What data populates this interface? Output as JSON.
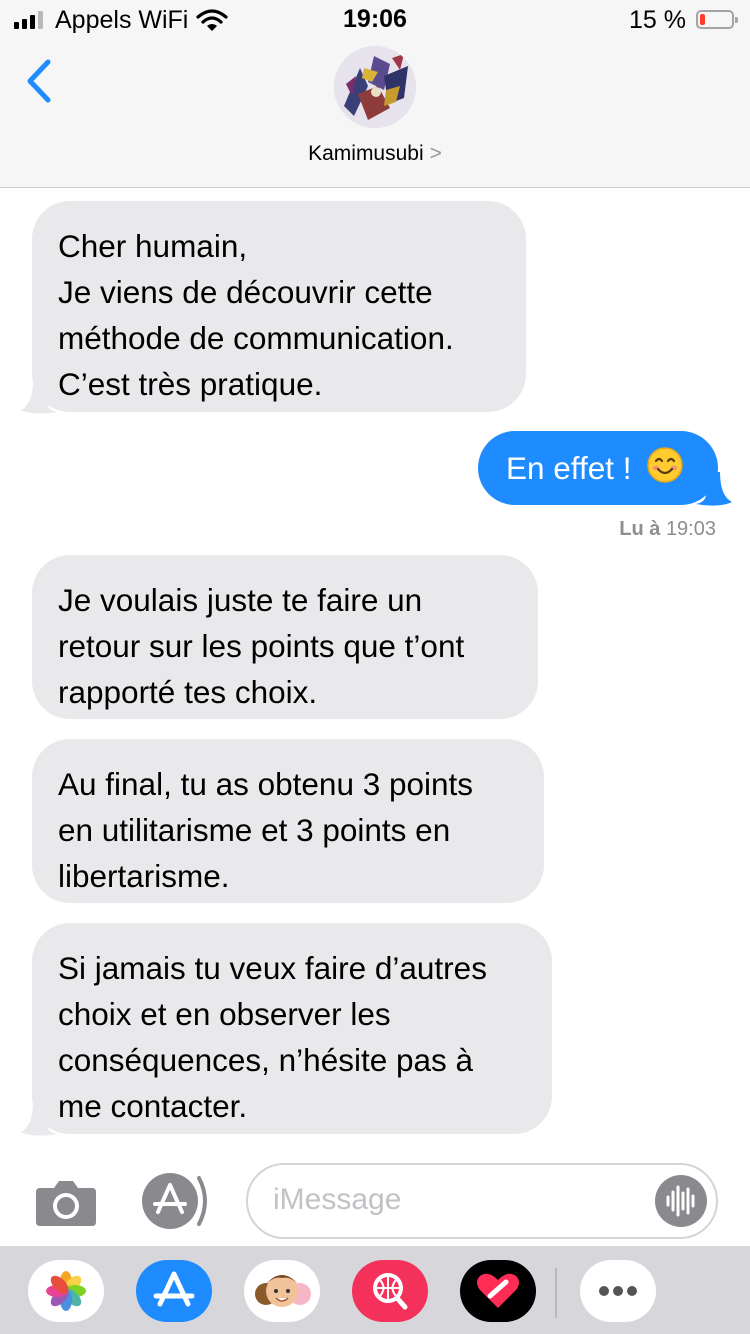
{
  "status_bar": {
    "carrier": "Appels WiFi",
    "time": "19:06",
    "battery_percent": "15 %",
    "battery_level": 0.15
  },
  "header": {
    "contact_name": "Kamimusubi",
    "contact_chevron": ">"
  },
  "messages": [
    {
      "direction": "incoming",
      "lines": [
        "Cher humain,",
        "Je viens de découvrir cette",
        "méthode de communication.",
        "C’est très pratique."
      ]
    },
    {
      "direction": "outgoing",
      "lines": [
        "En effet !"
      ],
      "emoji": "smiling-face-icon"
    },
    {
      "direction": "incoming",
      "lines": [
        "Je voulais juste te faire un",
        "retour sur les points que t’ont",
        "rapporté tes choix."
      ]
    },
    {
      "direction": "incoming",
      "lines": [
        "Au final, tu as obtenu 3 points",
        "en utilitarisme et 3 points en",
        "libertarisme."
      ]
    },
    {
      "direction": "incoming",
      "lines": [
        "Si jamais tu veux faire d’autres",
        "choix et en observer les",
        "conséquences, n’hésite pas à",
        "me contacter."
      ]
    }
  ],
  "read_receipt": {
    "label": "Lu à",
    "time": "19:03"
  },
  "input": {
    "placeholder": "iMessage"
  },
  "drawer_apps": [
    "photos-icon",
    "app-store-icon",
    "memoji-icon",
    "image-search-icon",
    "digital-touch-icon",
    "more-icon"
  ],
  "colors": {
    "accent_blue": "#1e8cff",
    "incoming_bubble": "#e9e9eb",
    "battery_low": "#ff3b30"
  }
}
